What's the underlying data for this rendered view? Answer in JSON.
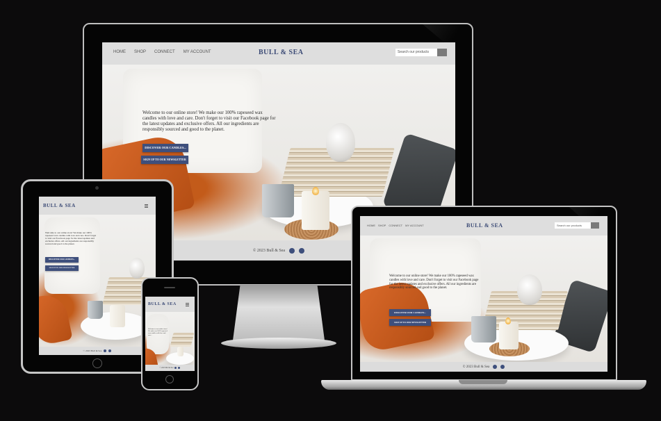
{
  "site": {
    "brand": "BULL & SEA",
    "nav": [
      "HOME",
      "SHOP",
      "CONNECT",
      "MY ACCOUNT"
    ],
    "search_placeholder": "Search our products",
    "hero_text_full": "Welcome to our online store! We make our 100% rapeseed wax candles with love and care. Don't forget to visit our Facebook page for the latest updates and exclusive offers. All our ingredients are responsibly sourced and good to the planet.",
    "hero_text_phone": "Welcome to our online store! We make our 100% rapeseed wax candles with love and care...",
    "cta_primary": "DISCOVER OUR CANDLES...",
    "cta_secondary": "SIGN UP TO OUR NEWSLETTER",
    "footer": "© 2023 Bull & Sea",
    "icons": [
      "facebook-icon",
      "pinterest-icon"
    ]
  },
  "colors": {
    "background": "#0c0b0c",
    "brand": "#3b4a75",
    "button": "#3e4f7c",
    "nav_bg": "#dedede"
  }
}
